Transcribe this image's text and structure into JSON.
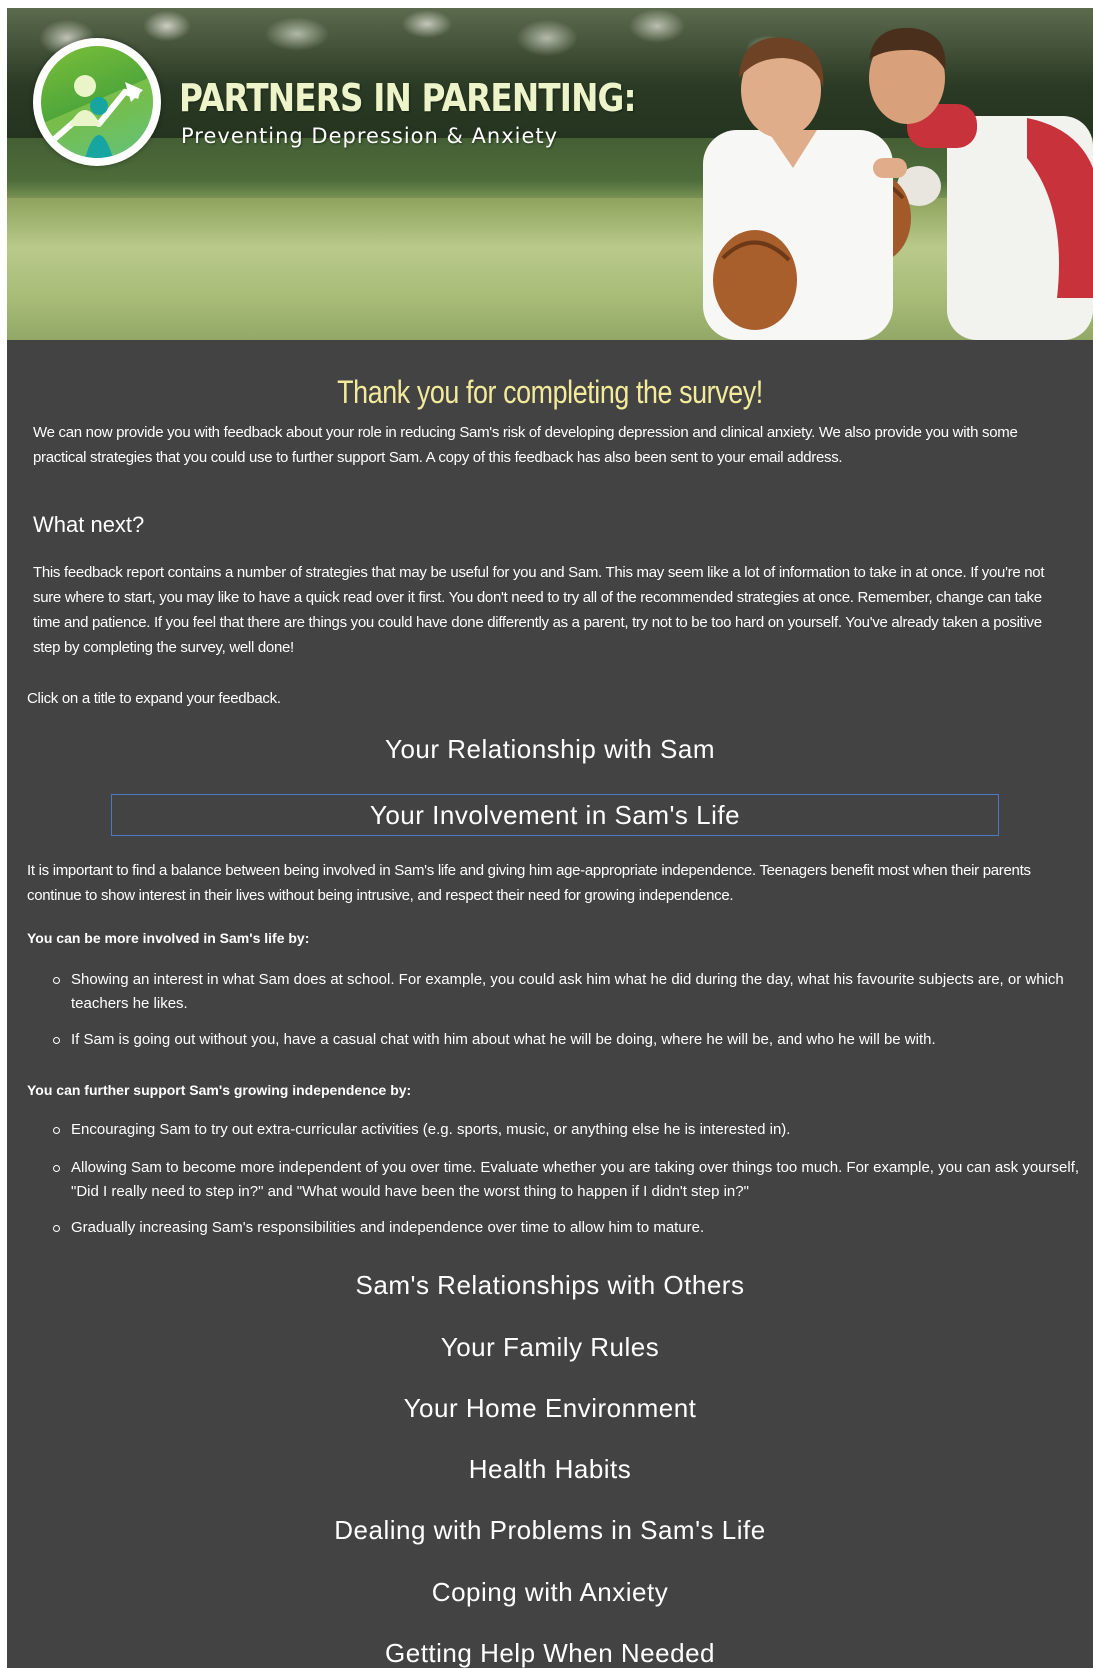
{
  "brand": {
    "title": "PARTNERS IN PARENTING:",
    "subtitle": "Preventing Depression & Anxiety",
    "accent_color": "#eef4c9"
  },
  "heading": "Thank you for completing the survey!",
  "intro": "We can now provide you with feedback about your role in reducing Sam's risk of developing depression and clinical anxiety. We also provide you with some practical strategies that you could use to further support Sam. A copy of this feedback has also been sent to your email address.",
  "what_next": {
    "title": "What next?",
    "body": "This feedback report contains a number of strategies that may be useful for you and Sam. This may seem like a lot of information to take in at once. If you're not sure where to start, you may like to have a quick read over it first. You don't need to try all of the recommended strategies at once. Remember, change can take time and patience. If you feel that there are things you could have done differently as a parent, try not to be too hard on yourself. You've already taken a positive step by completing the survey, well done!"
  },
  "instruction": "Click on a title to expand your feedback.",
  "sections": [
    "Your Relationship with Sam",
    "Your Involvement in Sam's Life",
    "Sam's Relationships with Others",
    "Your Family Rules",
    "Your Home Environment",
    "Health Habits",
    "Dealing with Problems in Sam's Life",
    "Coping with Anxiety",
    "Getting Help When Needed"
  ],
  "expanded": {
    "intro": "It is important to find a balance between being involved in Sam's life and giving him age-appropriate independence. Teenagers benefit most when their parents continue to show interest in their lives without being intrusive, and respect their need for growing independence.",
    "group1_label": "You can be more involved in Sam's life by:",
    "group1_items": [
      "Showing an interest in what Sam does at school. For example, you could ask him what he did during the day, what his favourite subjects are, or which teachers he likes.",
      "If Sam is going out without you, have a casual chat with him about what he will be doing, where he will be, and who he will be with."
    ],
    "group2_label": "You can further support Sam's growing independence by:",
    "group2_items": [
      "Encouraging Sam to try out extra-curricular activities (e.g. sports, music, or anything else he is interested in).",
      "Allowing Sam to become more independent of you over time. Evaluate whether you are taking over things too much. For example, you can ask yourself, \"Did I really need to step in?\" and \"What would have been the worst thing to happen if I didn't step in?\"",
      "Gradually increasing Sam's responsibilities and independence over time to allow him to mature."
    ]
  },
  "colors": {
    "background": "#434343",
    "heading": "#f3eb9b",
    "active_border": "#4d78c4"
  }
}
